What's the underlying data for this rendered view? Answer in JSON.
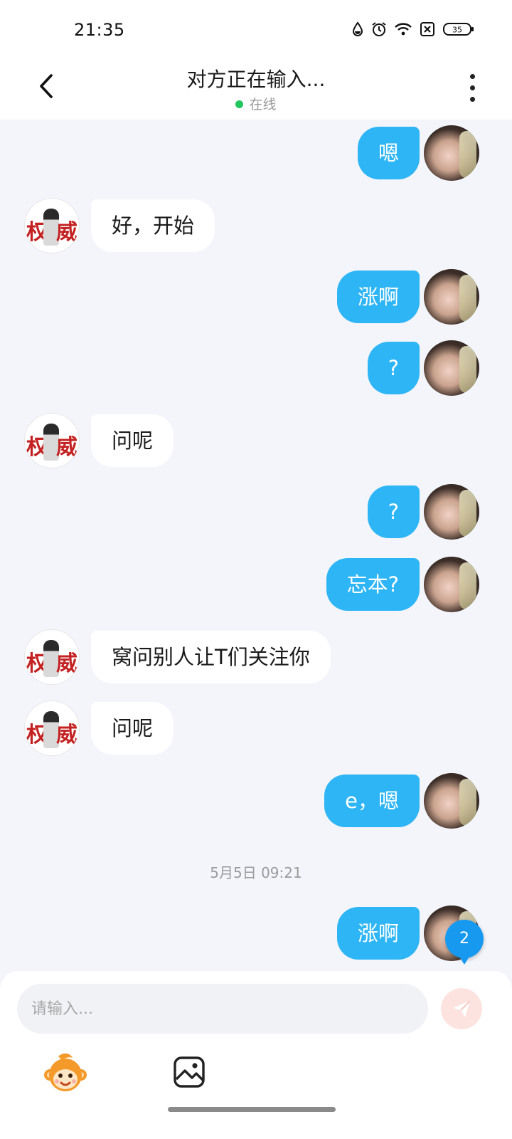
{
  "status_bar": {
    "time": "21:35",
    "battery": "35"
  },
  "header": {
    "title": "对方正在输入...",
    "online_status": "在线"
  },
  "messages": [
    {
      "side": "out",
      "text": "嗯"
    },
    {
      "side": "in",
      "text": "好，开始"
    },
    {
      "side": "out",
      "text": "涨啊"
    },
    {
      "side": "out",
      "text": "?"
    },
    {
      "side": "in",
      "text": "问呢"
    },
    {
      "side": "out",
      "text": "?"
    },
    {
      "side": "out",
      "text": "忘本?"
    },
    {
      "side": "in",
      "text": "窝问别人让T们关注你"
    },
    {
      "side": "in",
      "text": "问呢"
    },
    {
      "side": "out",
      "text": "e，嗯"
    },
    {
      "side": "out",
      "text": "涨啊"
    }
  ],
  "peer_avatar_text": [
    "权",
    "威"
  ],
  "timestamp": "5月5日 09:21",
  "unread_badge": "2",
  "input": {
    "placeholder": "请输入..."
  },
  "colors": {
    "outgoing_bubble": "#2eb5f5",
    "incoming_bubble": "#ffffff",
    "chat_background": "#f3f5fa",
    "online_dot": "#22c55e",
    "send_button": "#fde3e0",
    "unread_badge": "#1799f0"
  },
  "icons": {
    "back": "chevron-left-icon",
    "more": "more-vertical-icon",
    "send": "paper-plane-icon",
    "sticker": "monkey-sticker-icon",
    "image": "image-icon"
  }
}
